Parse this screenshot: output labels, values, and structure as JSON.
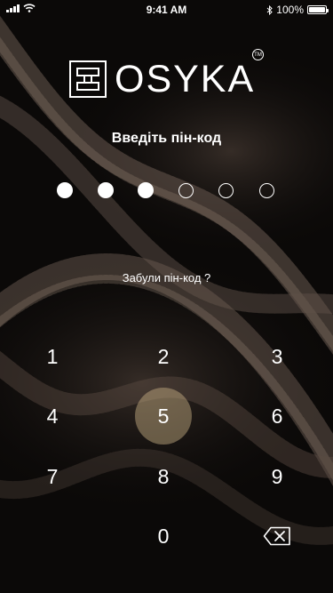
{
  "status_bar": {
    "time": "9:41 AM",
    "battery": "100%",
    "icons": [
      "signal-icon",
      "wifi-icon",
      "bluetooth-icon",
      "battery-icon"
    ]
  },
  "logo": {
    "text": "OSYKA",
    "trademark": "TM"
  },
  "pin_screen": {
    "title": "Введіть пін-код",
    "pin_length": 6,
    "entered_count": 3,
    "forgot_link": "Забули пін-код ?"
  },
  "keypad": {
    "keys": [
      "1",
      "2",
      "3",
      "4",
      "5",
      "6",
      "7",
      "8",
      "9",
      "0"
    ],
    "pressed_key": "5",
    "backspace_icon": "backspace-icon"
  },
  "colors": {
    "background": "#0b0908",
    "text": "#ffffff",
    "pressed_highlight": "#cdb487"
  }
}
